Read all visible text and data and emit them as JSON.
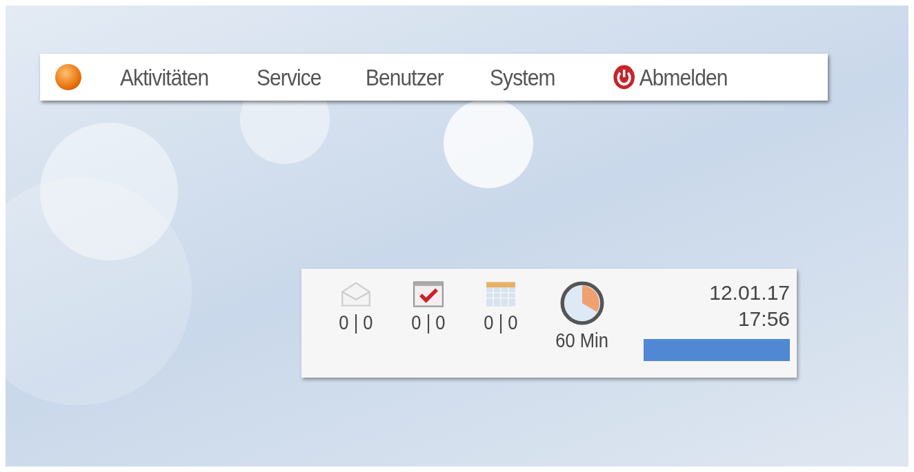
{
  "menu": {
    "items": [
      {
        "label": "Aktivitäten"
      },
      {
        "label": "Service"
      },
      {
        "label": "Benutzer"
      },
      {
        "label": "System"
      }
    ],
    "logout": {
      "label": "Abmelden"
    }
  },
  "status_panel": {
    "indicators": [
      {
        "kind": "mail",
        "count": "0 | 0"
      },
      {
        "kind": "tasks",
        "count": "0 | 0"
      },
      {
        "kind": "calendar",
        "count": "0 | 0"
      },
      {
        "kind": "timer",
        "count": "60 Min"
      }
    ],
    "date": "12.01.17",
    "time": "17:56"
  }
}
